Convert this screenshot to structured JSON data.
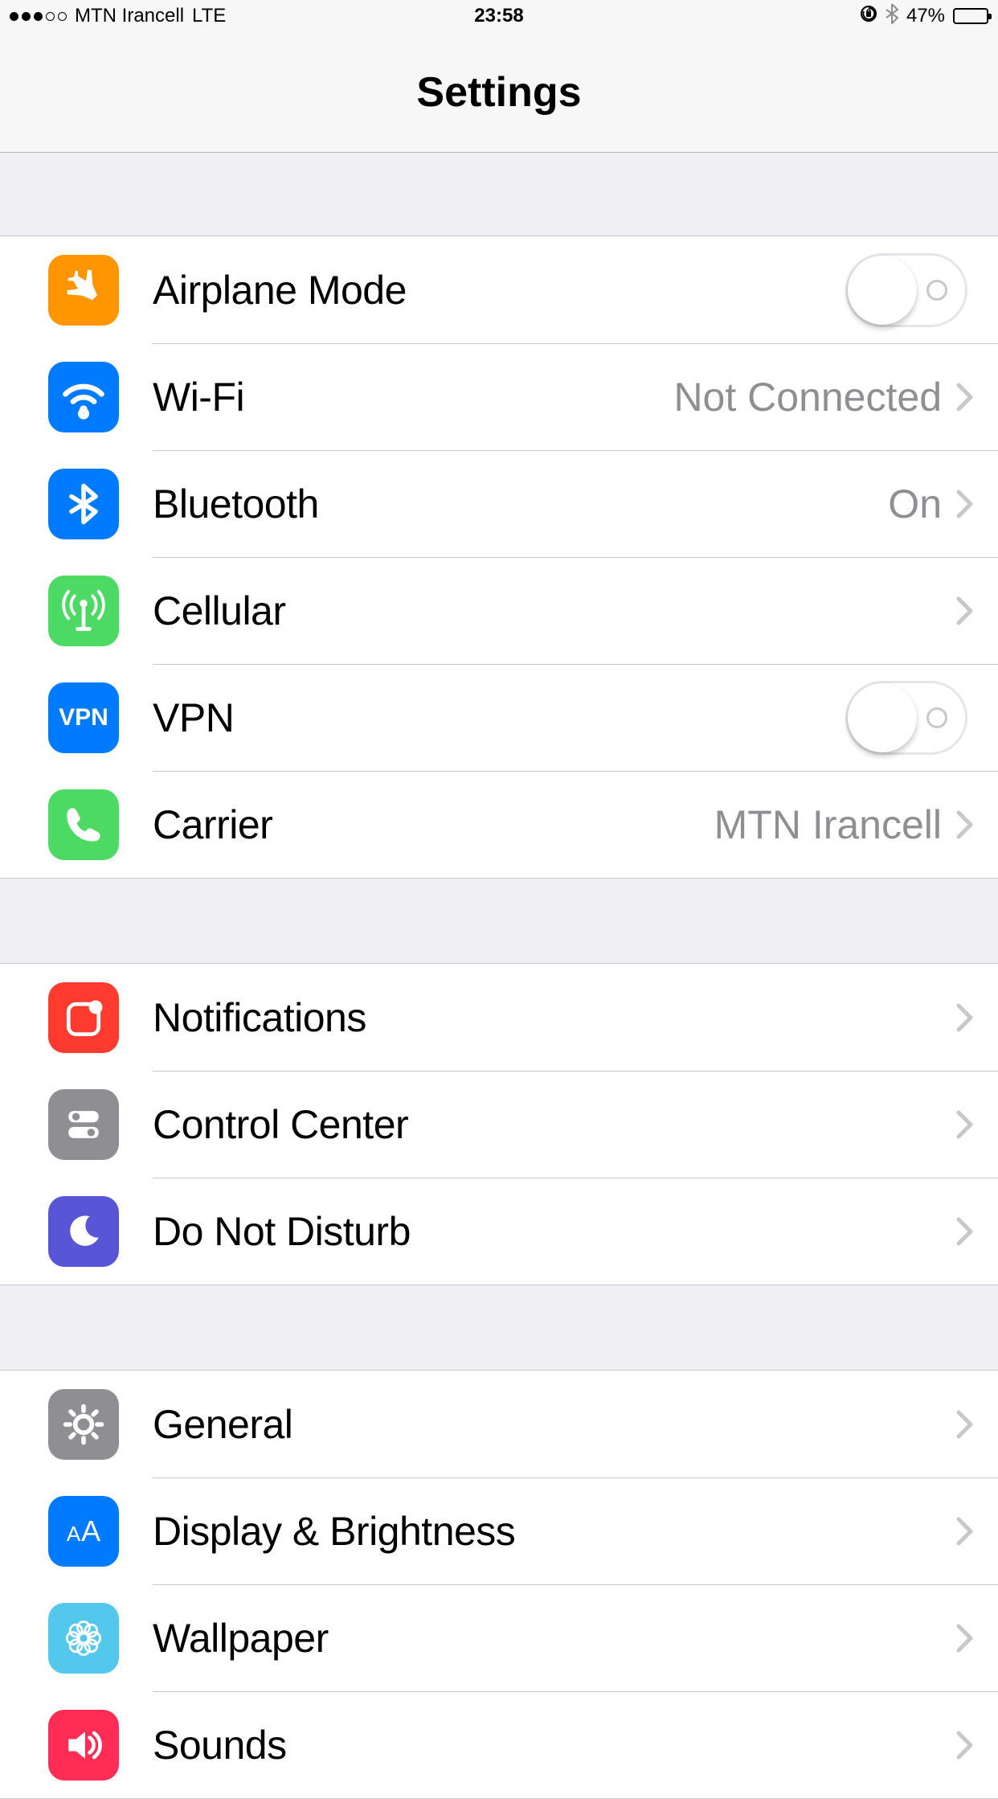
{
  "statusBar": {
    "carrier": "MTN Irancell",
    "network": "LTE",
    "time": "23:58",
    "batteryPercent": "47%"
  },
  "nav": {
    "title": "Settings"
  },
  "groups": [
    {
      "rows": [
        {
          "id": "airplane",
          "label": "Airplane Mode",
          "type": "toggle",
          "value": "off"
        },
        {
          "id": "wifi",
          "label": "Wi-Fi",
          "type": "nav",
          "detail": "Not Connected"
        },
        {
          "id": "bluetooth",
          "label": "Bluetooth",
          "type": "nav",
          "detail": "On"
        },
        {
          "id": "cellular",
          "label": "Cellular",
          "type": "nav",
          "detail": ""
        },
        {
          "id": "vpn",
          "label": "VPN",
          "type": "toggle",
          "value": "off"
        },
        {
          "id": "carrier",
          "label": "Carrier",
          "type": "nav",
          "detail": "MTN Irancell"
        }
      ]
    },
    {
      "rows": [
        {
          "id": "notifications",
          "label": "Notifications",
          "type": "nav",
          "detail": ""
        },
        {
          "id": "controlcenter",
          "label": "Control Center",
          "type": "nav",
          "detail": ""
        },
        {
          "id": "dnd",
          "label": "Do Not Disturb",
          "type": "nav",
          "detail": ""
        }
      ]
    },
    {
      "rows": [
        {
          "id": "general",
          "label": "General",
          "type": "nav",
          "detail": ""
        },
        {
          "id": "display",
          "label": "Display & Brightness",
          "type": "nav",
          "detail": ""
        },
        {
          "id": "wallpaper",
          "label": "Wallpaper",
          "type": "nav",
          "detail": ""
        },
        {
          "id": "sounds",
          "label": "Sounds",
          "type": "nav",
          "detail": ""
        }
      ]
    }
  ]
}
